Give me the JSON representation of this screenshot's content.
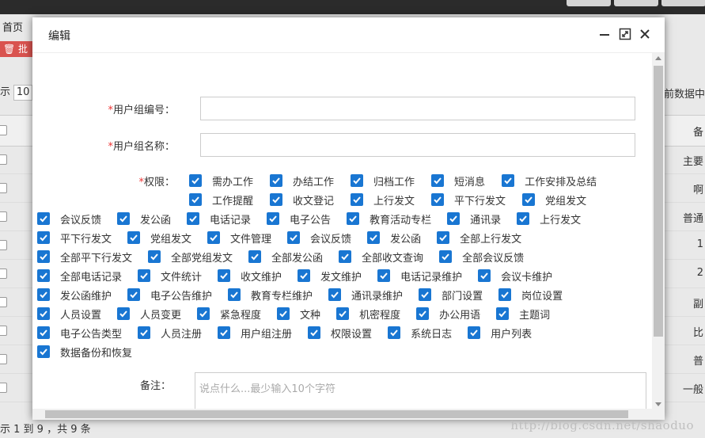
{
  "background": {
    "tab_home": "首页",
    "batch_button": "🗑 批",
    "show_prefix": "示",
    "page_size": "10",
    "right_text": "当前数据中",
    "header_right": "备",
    "rows": [
      "主要",
      "啊",
      "普通",
      "1",
      "2",
      "副",
      "比",
      "普",
      "一般"
    ],
    "footer_text": "示 1 到 9 ，共 9 条"
  },
  "watermark": "http://blog.csdn.net/shaoduo",
  "modal": {
    "title": "编辑",
    "icons": [
      "minimize-icon",
      "maximize-icon",
      "close-icon"
    ],
    "fields": {
      "group_no_label": "用户组编号：",
      "group_no_value": "",
      "group_name_label": "用户组名称：",
      "group_name_value": "",
      "required_mark": "*",
      "perm_label": "权限：",
      "note_label": "备注：",
      "note_placeholder": "说点什么...最少输入10个字符"
    },
    "permissions": {
      "row1": [
        "需办工作",
        "办结工作",
        "归档工作",
        "短消息",
        "工作安排及总结"
      ],
      "row2": [
        "工作提醒",
        "收文登记",
        "上行发文",
        "平下行发文",
        "党组发文"
      ],
      "row3": [
        "会议反馈",
        "发公函",
        "电话记录",
        "电子公告",
        "教育活动专栏",
        "通讯录",
        "上行发文"
      ],
      "row4": [
        "平下行发文",
        "党组发文",
        "文件管理",
        "会议反馈",
        "发公函",
        "全部上行发文"
      ],
      "row5": [
        "全部平下行发文",
        "全部党组发文",
        "全部发公函",
        "全部收文查询",
        "全部会议反馈"
      ],
      "row6": [
        "全部电话记录",
        "文件统计",
        "收文维护",
        "发文维护",
        "电话记录维护",
        "会议卡维护"
      ],
      "row7": [
        "发公函维护",
        "电子公告维护",
        "教育专栏维护",
        "通讯录维护",
        "部门设置",
        "岗位设置"
      ],
      "row8": [
        "人员设置",
        "人员变更",
        "紧急程度",
        "文种",
        "机密程度",
        "办公用语",
        "主题词"
      ],
      "row9": [
        "电子公告类型",
        "人员注册",
        "用户组注册",
        "权限设置",
        "系统日志",
        "用户列表"
      ],
      "row10": [
        "数据备份和恢复"
      ]
    },
    "checked": true,
    "colors": {
      "checkbox": "#1976d2",
      "required": "#ee3333"
    }
  }
}
